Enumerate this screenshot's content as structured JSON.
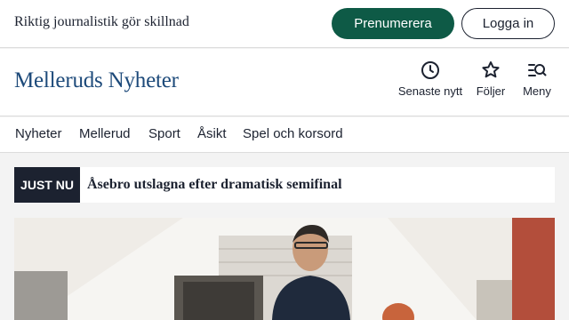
{
  "topbar": {
    "tagline": "Riktig journalistik gör skillnad",
    "subscribe_label": "Prenumerera",
    "login_label": "Logga in"
  },
  "header": {
    "logo": "Melleruds Nyheter",
    "latest_label": "Senaste nytt",
    "follow_label": "Följer",
    "menu_label": "Meny"
  },
  "nav": {
    "items": [
      "Nyheter",
      "Mellerud",
      "Sport",
      "Åsikt",
      "Spel och korsord"
    ]
  },
  "breaking": {
    "badge": "JUST NU",
    "headline": "Åsebro utslagna efter dramatisk semifinal"
  },
  "colors": {
    "brand_green": "#0e5a46",
    "logo_blue": "#1d4a7a",
    "dark": "#1c2230",
    "background": "#f3f3f3"
  }
}
